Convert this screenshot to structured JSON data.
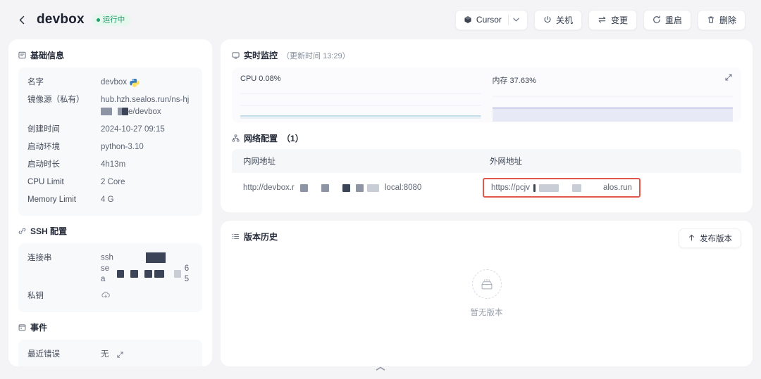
{
  "header": {
    "back_icon": "chevron-left-icon",
    "title": "devbox",
    "status": "运行中",
    "buttons": {
      "ide_label": "Cursor",
      "ide_icon": "cube-icon",
      "caret_icon": "chevron-down-icon",
      "shutdown": "关机",
      "shutdown_icon": "power-icon",
      "change": "变更",
      "change_icon": "swap-icon",
      "restart": "重启",
      "restart_icon": "refresh-icon",
      "delete": "删除",
      "delete_icon": "trash-icon"
    }
  },
  "basic_info": {
    "section_title": "基础信息",
    "section_icon": "list-card-icon",
    "rows": [
      {
        "key": "名字",
        "value": "devbox",
        "icon": "python-logo-icon"
      },
      {
        "key": "镜像源（私有）",
        "value_prefix": "hub.hzh.sealos.run/ns-hj",
        "value_suffix": "e/devbox"
      },
      {
        "key": "创建时间",
        "value": "2024-10-27 09:15"
      },
      {
        "key": "启动环境",
        "value": "python-3.10"
      },
      {
        "key": "启动时长",
        "value": "4h13m"
      },
      {
        "key": "CPU Limit",
        "value": "2 Core"
      },
      {
        "key": "Memory Limit",
        "value": "4 G"
      }
    ]
  },
  "ssh_config": {
    "section_title": "SSH 配置",
    "section_icon": "link-icon",
    "conn_key": "连接串",
    "conn_line1": "ssh",
    "conn_line2": "sea",
    "conn_tail": "65",
    "key_key": "私钥",
    "key_icon": "download-cloud-icon"
  },
  "events": {
    "section_title": "事件",
    "section_icon": "calendar-icon",
    "recent_error_key": "最近错误",
    "recent_error_value": "无",
    "expand_icon": "expand-icon"
  },
  "monitor": {
    "section_title": "实时监控",
    "section_icon": "monitor-icon",
    "section_sub": "（更新时间 13:29）",
    "cpu_label": "CPU 0.08%",
    "mem_label": "内存 37.63%",
    "expand_icon": "expand-icon"
  },
  "network": {
    "section_title": "网络配置",
    "section_icon": "network-icon",
    "section_sub": "（1）",
    "col_internal": "内网地址",
    "col_external": "外网地址",
    "internal_prefix": "http://devbox.r",
    "internal_suffix": "local:8080",
    "external_prefix": "https://pcjv",
    "external_suffix": "alos.run",
    "highlight_color": "#e2574c"
  },
  "version_history": {
    "section_title": "版本历史",
    "section_icon": "list-icon",
    "release_label": "发布版本",
    "release_icon": "upload-arrow-icon",
    "empty_icon": "empty-box-icon",
    "empty_text": "暂无版本"
  },
  "bottom": {
    "handle_icon": "collapse-handle-icon"
  }
}
